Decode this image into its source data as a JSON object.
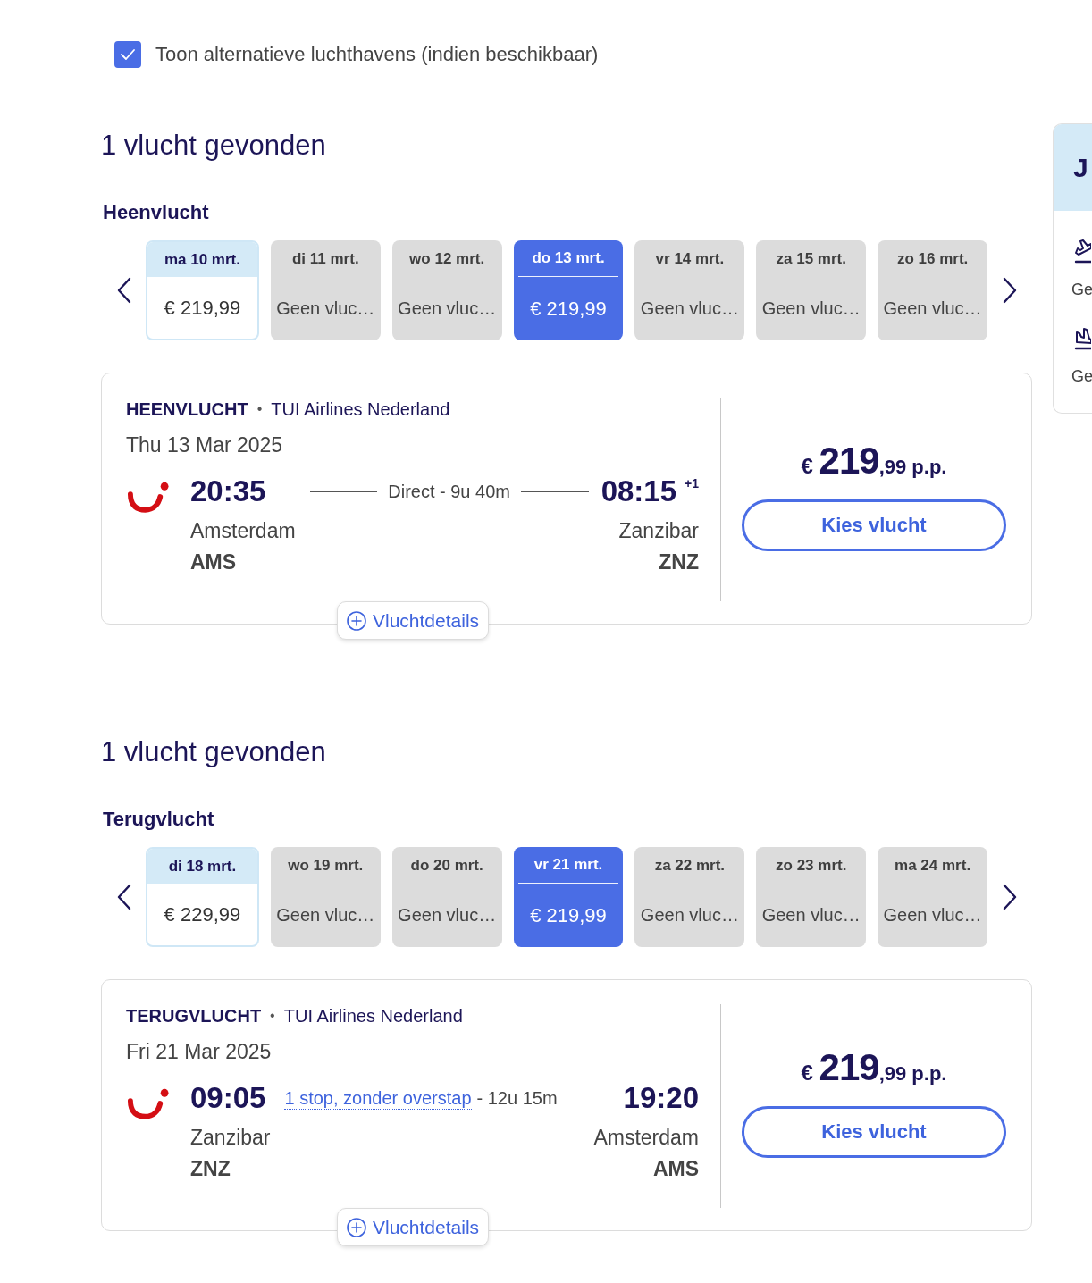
{
  "alternative_airports": {
    "label": "Toon alternatieve luchthavens (indien beschikbaar)",
    "checked": true
  },
  "sections": [
    {
      "heading": "1 vlucht gevonden",
      "subheading": "Heenvlucht",
      "dates": [
        {
          "day": "ma 10 mrt.",
          "price": "€ 219,99",
          "selected": false,
          "disabled": false
        },
        {
          "day": "di 11 mrt.",
          "price": "Geen vluc…",
          "selected": false,
          "disabled": true
        },
        {
          "day": "wo 12 mrt.",
          "price": "Geen vluc…",
          "selected": false,
          "disabled": true
        },
        {
          "day": "do 13 mrt.",
          "price": "€ 219,99",
          "selected": true,
          "disabled": false
        },
        {
          "day": "vr 14 mrt.",
          "price": "Geen vluc…",
          "selected": false,
          "disabled": true
        },
        {
          "day": "za 15 mrt.",
          "price": "Geen vluc…",
          "selected": false,
          "disabled": true
        },
        {
          "day": "zo 16 mrt.",
          "price": "Geen vluc…",
          "selected": false,
          "disabled": true
        }
      ],
      "flight": {
        "direction": "HEENVLUCHT",
        "separator": "•",
        "airline": "TUI Airlines Nederland",
        "date": "Thu 13 Mar 2025",
        "departure": {
          "time": "20:35",
          "city": "Amsterdam",
          "code": "AMS"
        },
        "route": {
          "kind": "direct",
          "text": "Direct - 9u 40m"
        },
        "arrival": {
          "time": "08:15",
          "day_offset": "+1",
          "city": "Zanzibar",
          "code": "ZNZ"
        },
        "price": {
          "currency": "€",
          "whole": "219",
          "fraction": ",99",
          "unit": "p.p."
        },
        "select_button": "Kies vlucht",
        "details_button": "Vluchtdetails"
      }
    },
    {
      "heading": "1 vlucht gevonden",
      "subheading": "Terugvlucht",
      "dates": [
        {
          "day": "di 18 mrt.",
          "price": "€ 229,99",
          "selected": false,
          "disabled": false
        },
        {
          "day": "wo 19 mrt.",
          "price": "Geen vluc…",
          "selected": false,
          "disabled": true
        },
        {
          "day": "do 20 mrt.",
          "price": "Geen vluc…",
          "selected": false,
          "disabled": true
        },
        {
          "day": "vr 21 mrt.",
          "price": "€ 219,99",
          "selected": true,
          "disabled": false
        },
        {
          "day": "za 22 mrt.",
          "price": "Geen vluc…",
          "selected": false,
          "disabled": true
        },
        {
          "day": "zo 23 mrt.",
          "price": "Geen vluc…",
          "selected": false,
          "disabled": true
        },
        {
          "day": "ma 24 mrt.",
          "price": "Geen vluc…",
          "selected": false,
          "disabled": true
        }
      ],
      "flight": {
        "direction": "TERUGVLUCHT",
        "separator": "•",
        "airline": "TUI Airlines Nederland",
        "date": "Fri 21 Mar 2025",
        "departure": {
          "time": "09:05",
          "city": "Zanzibar",
          "code": "ZNZ"
        },
        "route": {
          "kind": "stops",
          "link": "1 stop, zonder overstap",
          "text": "- 12u 15m"
        },
        "arrival": {
          "time": "19:20",
          "city": "Amsterdam",
          "code": "AMS"
        },
        "price": {
          "currency": "€",
          "whole": "219",
          "fraction": ",99",
          "unit": "p.p."
        },
        "select_button": "Kies vlucht",
        "details_button": "Vluchtdetails"
      }
    }
  ],
  "side_panel": {
    "title": "J",
    "items": [
      {
        "kind": "departure",
        "text": "Ge"
      },
      {
        "kind": "arrival",
        "text": "Ge"
      }
    ]
  }
}
